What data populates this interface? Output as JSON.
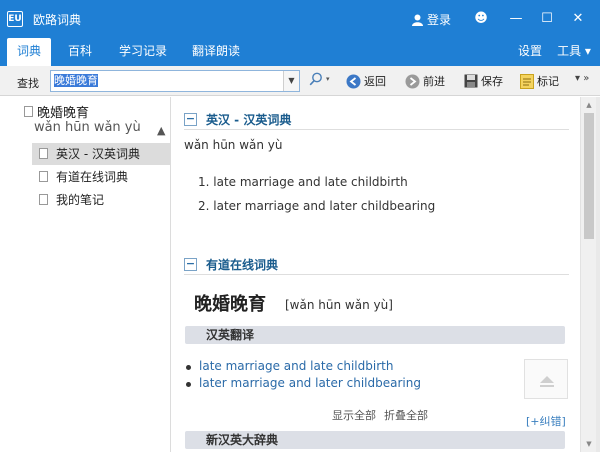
{
  "app": {
    "title": "欧路词典",
    "logo_text": "EU"
  },
  "titlebar": {
    "login": "登录",
    "smiley_icon": "☻",
    "minimize_icon": "—",
    "maximize_icon": "☐",
    "close_icon": "✕"
  },
  "tabs": [
    {
      "label": "词典",
      "active": true
    },
    {
      "label": "百科"
    },
    {
      "label": "学习记录"
    },
    {
      "label": "翻译朗读"
    }
  ],
  "tab_right": {
    "settings": "设置",
    "tools": "工具 ▾"
  },
  "toolbar": {
    "find_label": "查找",
    "search_value": "晚婚晚育",
    "dropdown": "▼",
    "back": "返回",
    "forward": "前进",
    "save": "保存",
    "mark": "标记",
    "more": "▾ »"
  },
  "sidebar": {
    "head_word": "晚婚晚育",
    "head_pinyin": "wǎn hūn wǎn yù",
    "collapse": "▲",
    "items": [
      {
        "label": "英汉 - 汉英词典",
        "selected": true
      },
      {
        "label": "有道在线词典"
      },
      {
        "label": "我的笔记"
      }
    ]
  },
  "main": {
    "section1": {
      "minus": "−",
      "title": "英汉 - 汉英词典"
    },
    "pinyin": "wǎn hūn wǎn yù",
    "defs": [
      "1.  late marriage and late childbirth",
      "2.  later marriage and later childbearing"
    ],
    "section2": {
      "minus": "−",
      "title": "有道在线词典"
    },
    "word": "晚婚晚育",
    "word_pinyin": "[wǎn hūn wǎn yù]",
    "band1": "汉英翻译",
    "links": [
      "late marriage and late childbirth",
      "later marriage and later childbearing"
    ],
    "show_all": "显示全部",
    "fold_all": "折叠全部",
    "correct": "[+纠错]",
    "band2": "新汉英大辞典"
  },
  "scroll": {
    "up": "▲",
    "down": "▼"
  },
  "colors": {
    "brand": "#1f7fd4",
    "link": "#2a6aa8",
    "section_title": "#1a5c8d"
  }
}
